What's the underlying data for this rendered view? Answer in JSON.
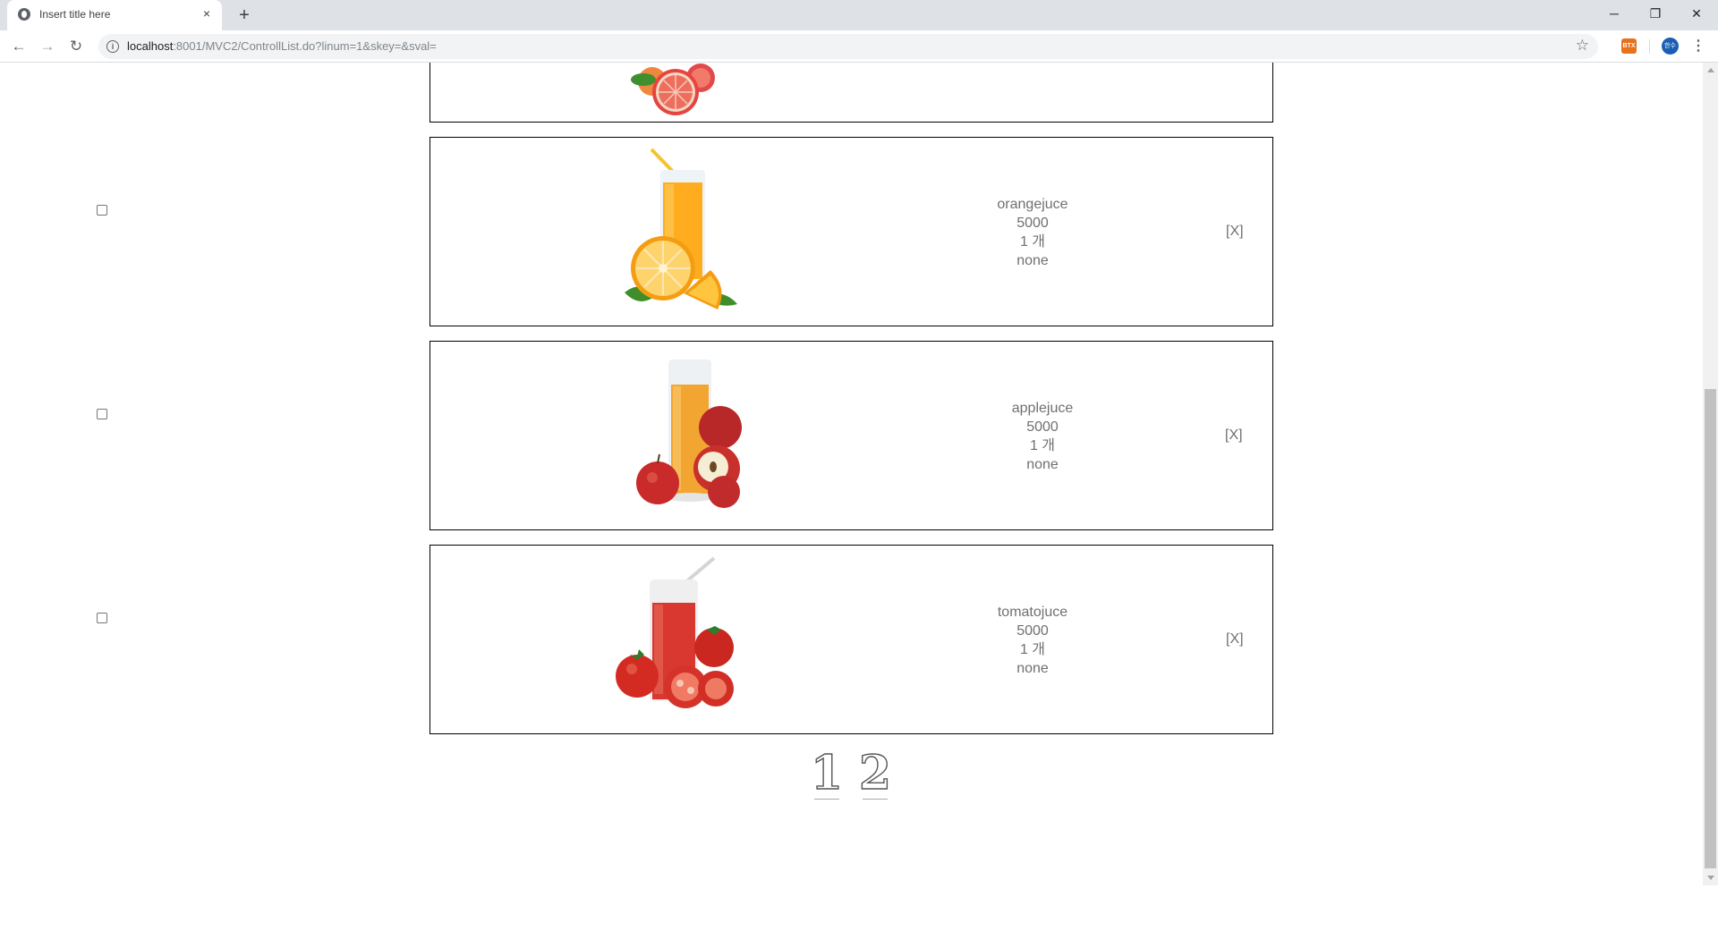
{
  "browser": {
    "tab_title": "Insert title here",
    "tab_close": "×",
    "new_tab": "+",
    "url_host": "localhost",
    "url_rest": ":8001/MVC2/ControllList.do?linum=1&skey=&sval=",
    "window_controls": {
      "minimize": "─",
      "restore": "❐",
      "close": "✕"
    },
    "extension_label": "BTX",
    "profile_label": "한수",
    "menu_icon": "⋮",
    "nav": {
      "back": "←",
      "forward": "→",
      "reload": "↻"
    }
  },
  "cart": {
    "items": [
      {
        "name": "",
        "price": "",
        "quantity": "",
        "option": "",
        "remove_label": "",
        "image": "grapefruit-slices-icon"
      },
      {
        "name": "orangejuce",
        "price": "5000",
        "quantity": "1 개",
        "option": "none",
        "remove_label": "[X]",
        "image": "orange-juice-glass-icon"
      },
      {
        "name": "applejuce",
        "price": "5000",
        "quantity": "1 개",
        "option": "none",
        "remove_label": "[X]",
        "image": "apple-juice-glass-icon"
      },
      {
        "name": "tomatojuce",
        "price": "5000",
        "quantity": "1 개",
        "option": "none",
        "remove_label": "[X]",
        "image": "tomato-juice-glass-icon"
      }
    ]
  },
  "pagination": {
    "pages": [
      "1",
      "2"
    ]
  },
  "colors": {
    "card_border": "#000000",
    "item_text": "#707070",
    "chrome_bg": "#dee1e6"
  }
}
